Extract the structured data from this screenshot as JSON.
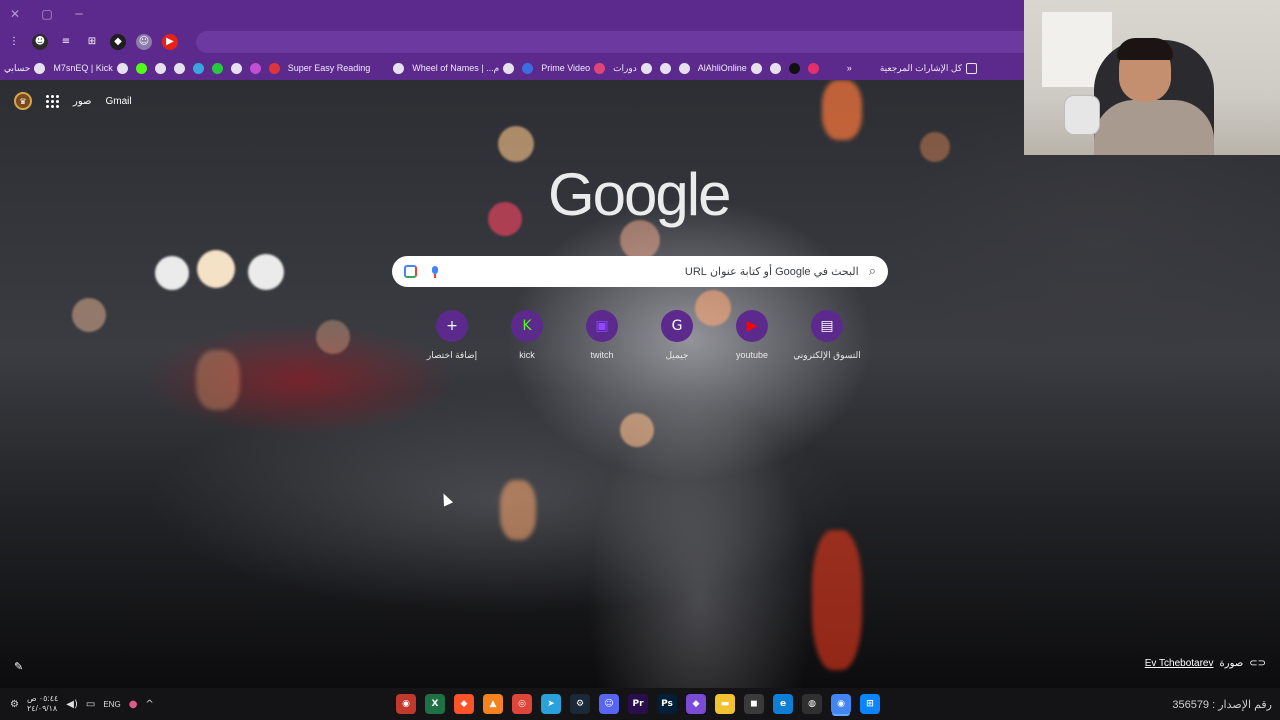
{
  "window": {
    "controls": [
      "✕",
      "▢",
      "─"
    ]
  },
  "toolbar": {
    "icons": [
      {
        "name": "menu-kebab-icon",
        "glyph": "⋮",
        "color": "#5b2a8c"
      },
      {
        "name": "profile-extension-icon",
        "glyph": "☻",
        "color": "#2b2b2b"
      },
      {
        "name": "media-control-icon",
        "glyph": "≡",
        "color": "#5b2a8c"
      },
      {
        "name": "extensions-puzzle-icon",
        "glyph": "⊞",
        "color": "#5b2a8c"
      },
      {
        "name": "extension-diamond-icon",
        "glyph": "◆",
        "color": "#1f1f1f"
      },
      {
        "name": "extension-face-icon",
        "glyph": "☺",
        "color": "#8c7aa8"
      },
      {
        "name": "youtube-extension-icon",
        "glyph": "▶",
        "color": "#e62117"
      }
    ]
  },
  "bookmarks": {
    "all_bookmarks": "كل الإشارات المرجعية",
    "overflow": "»",
    "items": [
      {
        "label": "حسابي",
        "icon_color": "#e7e0ef"
      },
      {
        "label": "M7snEQ | Kick",
        "icon_color": "#e7e0ef"
      },
      {
        "label": "",
        "icon_color": "#53fc18"
      },
      {
        "label": "",
        "icon_color": "#e7e0ef"
      },
      {
        "label": "",
        "icon_color": "#e7e0ef"
      },
      {
        "label": "",
        "icon_color": "#3aa6e0"
      },
      {
        "label": "",
        "icon_color": "#27c93f"
      },
      {
        "label": "",
        "icon_color": "#e7e0ef"
      },
      {
        "label": "",
        "icon_color": "#c14fd4"
      },
      {
        "label": "",
        "icon_color": "#e0343b"
      },
      {
        "label": "Super Easy Reading",
        "icon_color": "#5b2a8c"
      },
      {
        "label": "",
        "icon_color": "#e7e0ef"
      },
      {
        "label": "Wheel of Names | ...م",
        "icon_color": "#e7e0ef"
      },
      {
        "label": "",
        "icon_color": "#3c6ee0"
      },
      {
        "label": "Prime Video",
        "icon_color": "#e0447b"
      },
      {
        "label": "دورات",
        "icon_color": "#e7e0ef"
      },
      {
        "label": "",
        "icon_color": "#e7e0ef"
      },
      {
        "label": "",
        "icon_color": "#e7e0ef"
      },
      {
        "label": "AlAhliOnline",
        "icon_color": "#e7e0ef"
      },
      {
        "label": "",
        "icon_color": "#e7e0ef"
      },
      {
        "label": "",
        "icon_color": "#111111"
      },
      {
        "label": "",
        "icon_color": "#e1306c"
      }
    ]
  },
  "ntp": {
    "links": {
      "gmail": "Gmail",
      "images": "صور"
    },
    "logo": "Google",
    "search_placeholder": "البحث في Google أو كتابة عنوان URL",
    "shortcuts": [
      {
        "title": "إضافة اختصار",
        "glyph": "+",
        "color": "#5b2a8c",
        "icon": "add-shortcut-icon"
      },
      {
        "title": "kick",
        "glyph": "K",
        "color": "#53fc18",
        "icon": "kick-icon"
      },
      {
        "title": "twitch",
        "glyph": "▣",
        "color": "#9146ff",
        "icon": "twitch-icon"
      },
      {
        "title": "جيميل",
        "glyph": "G",
        "color": "#ffffff",
        "icon": "google-icon"
      },
      {
        "title": "youtube",
        "glyph": "▶",
        "color": "#ff0000",
        "icon": "youtube-icon"
      },
      {
        "title": "التسوق الإلكتروني",
        "glyph": "▤",
        "color": "#ffffff",
        "icon": "shopping-icon"
      }
    ],
    "attribution_photo": "صورة",
    "attribution_author": "Ev Tchebotarev"
  },
  "taskbar": {
    "time": "٠٥:٤٤ ص",
    "date": "٢٤/٠٩/١٨",
    "language": "ENG",
    "version_label": "رقم الإصدار : 356579",
    "apps": [
      {
        "name": "mic-recorder-icon",
        "glyph": "◉",
        "color": "#c0392b"
      },
      {
        "name": "excel-icon",
        "glyph": "X",
        "color": "#1e7145"
      },
      {
        "name": "brave-icon",
        "glyph": "◆",
        "color": "#fb542b"
      },
      {
        "name": "vlc-icon",
        "glyph": "▲",
        "color": "#f58220"
      },
      {
        "name": "app-red-icon",
        "glyph": "◎",
        "color": "#e0453a"
      },
      {
        "name": "telegram-icon",
        "glyph": "➤",
        "color": "#2aa1da"
      },
      {
        "name": "steam-icon",
        "glyph": "⚙",
        "color": "#1b2838"
      },
      {
        "name": "discord-icon",
        "glyph": "☺",
        "color": "#5865f2"
      },
      {
        "name": "premiere-icon",
        "glyph": "Pr",
        "color": "#2a0d4d"
      },
      {
        "name": "photoshop-icon",
        "glyph": "Ps",
        "color": "#001e36"
      },
      {
        "name": "video-editor-icon",
        "glyph": "◆",
        "color": "#7b4bd6"
      },
      {
        "name": "file-explorer-icon",
        "glyph": "▬",
        "color": "#f2c230"
      },
      {
        "name": "store-icon",
        "glyph": "◼",
        "color": "#3a3a3a"
      },
      {
        "name": "edge-icon",
        "glyph": "e",
        "color": "#0f7fd6"
      },
      {
        "name": "obs-icon",
        "glyph": "◍",
        "color": "#303030"
      },
      {
        "name": "chrome-icon",
        "glyph": "◉",
        "color": "#4285f4"
      },
      {
        "name": "windows-icon",
        "glyph": "⊞",
        "color": "#0a84ff"
      }
    ]
  }
}
